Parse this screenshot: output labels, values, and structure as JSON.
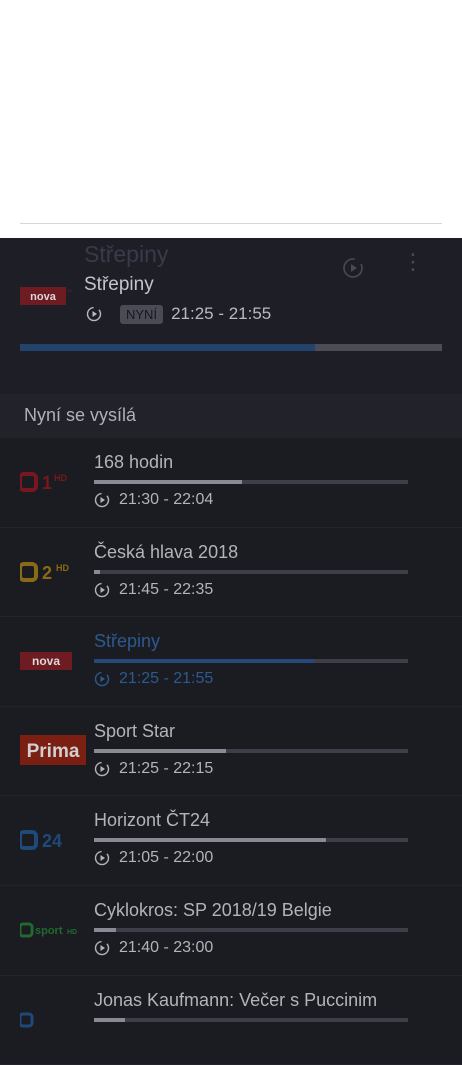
{
  "now_playing": {
    "title": "Střepiny",
    "subtitle": "Střepiny",
    "badge": "NYNÍ",
    "time": "21:25 - 21:55",
    "progress": 0.7,
    "channel_logo": "nova-logo"
  },
  "section": {
    "title": "Nyní se vysílá"
  },
  "channels": [
    {
      "logo": "ct1-hd-logo",
      "title": "168 hodin",
      "time": "21:30 - 22:04",
      "progress": 0.47,
      "active": false
    },
    {
      "logo": "ct2-hd-logo",
      "title": "Česká hlava 2018",
      "time": "21:45 - 22:35",
      "progress": 0.02,
      "active": false
    },
    {
      "logo": "nova-logo",
      "title": "Střepiny",
      "time": "21:25 - 21:55",
      "progress": 0.7,
      "active": true
    },
    {
      "logo": "prima-logo",
      "title": "Sport Star",
      "time": "21:25 - 22:15",
      "progress": 0.42,
      "active": false
    },
    {
      "logo": "ct24-logo",
      "title": "Horizont ČT24",
      "time": "21:05 - 22:00",
      "progress": 0.74,
      "active": false
    },
    {
      "logo": "ct-sport-hd-logo",
      "title": "Cyklokros: SP 2018/19 Belgie",
      "time": "21:40 - 23:00",
      "progress": 0.07,
      "active": false
    },
    {
      "logo": "ct-art-logo",
      "title": "Jonas Kaufmann: Večer s Puccinim",
      "time": "",
      "progress": 0.1,
      "active": false
    }
  ]
}
